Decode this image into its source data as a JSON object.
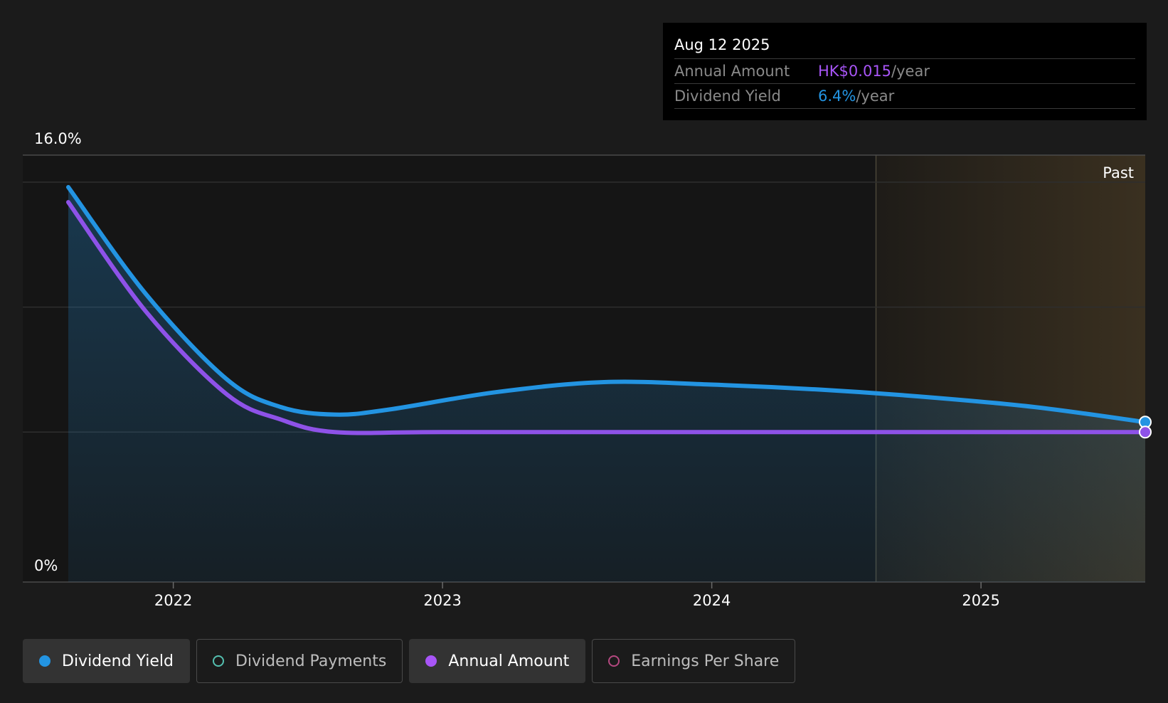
{
  "tooltip": {
    "date": "Aug 12 2025",
    "annual_amount_label": "Annual Amount",
    "annual_amount_value": "HK$0.015",
    "annual_amount_suffix": "/year",
    "dividend_yield_label": "Dividend Yield",
    "dividend_yield_value": "6.4%",
    "dividend_yield_suffix": "/year"
  },
  "colors": {
    "dividend_yield": "#2394e2",
    "annual_amount": "#8e52e8",
    "dividend_payments": "#54c0b0",
    "earnings_per_share": "#b54880",
    "past_region": "#3a3020",
    "background": "#1b1b1b"
  },
  "legend": [
    {
      "label": "Dividend Yield",
      "color": "#2394e2",
      "filled": true,
      "active": true
    },
    {
      "label": "Dividend Payments",
      "color": "#54c0b0",
      "filled": false,
      "active": false
    },
    {
      "label": "Annual Amount",
      "color": "#a855f7",
      "filled": true,
      "active": true
    },
    {
      "label": "Earnings Per Share",
      "color": "#b54880",
      "filled": false,
      "active": false
    }
  ],
  "chart_data": {
    "type": "line",
    "y_top_label": "16.0%",
    "y_bottom_label": "0%",
    "ylim": [
      0,
      16
    ],
    "xlim": [
      2021.61,
      2025.61
    ],
    "x_ticks": [
      2022,
      2023,
      2024,
      2025
    ],
    "x_tick_labels": [
      "2022",
      "2023",
      "2024",
      "2025"
    ],
    "past_label": "Past",
    "past_region_start": 2024.61,
    "grid": true,
    "series": [
      {
        "name": "Dividend Yield",
        "points": [
          [
            2021.61,
            15.8
          ],
          [
            2021.9,
            11.5
          ],
          [
            2022.2,
            8.1
          ],
          [
            2022.4,
            7.0
          ],
          [
            2022.6,
            6.7
          ],
          [
            2022.8,
            6.9
          ],
          [
            2023.2,
            7.6
          ],
          [
            2023.6,
            8.0
          ],
          [
            2024.0,
            7.9
          ],
          [
            2024.4,
            7.7
          ],
          [
            2024.8,
            7.4
          ],
          [
            2025.2,
            7.0
          ],
          [
            2025.61,
            6.4
          ]
        ]
      },
      {
        "name": "Annual Amount",
        "points": [
          [
            2021.61,
            15.2
          ],
          [
            2021.9,
            10.8
          ],
          [
            2022.2,
            7.5
          ],
          [
            2022.4,
            6.5
          ],
          [
            2022.6,
            6.0
          ],
          [
            2023.0,
            6.0
          ],
          [
            2024.0,
            6.0
          ],
          [
            2025.0,
            6.0
          ],
          [
            2025.61,
            6.0
          ]
        ]
      }
    ]
  }
}
